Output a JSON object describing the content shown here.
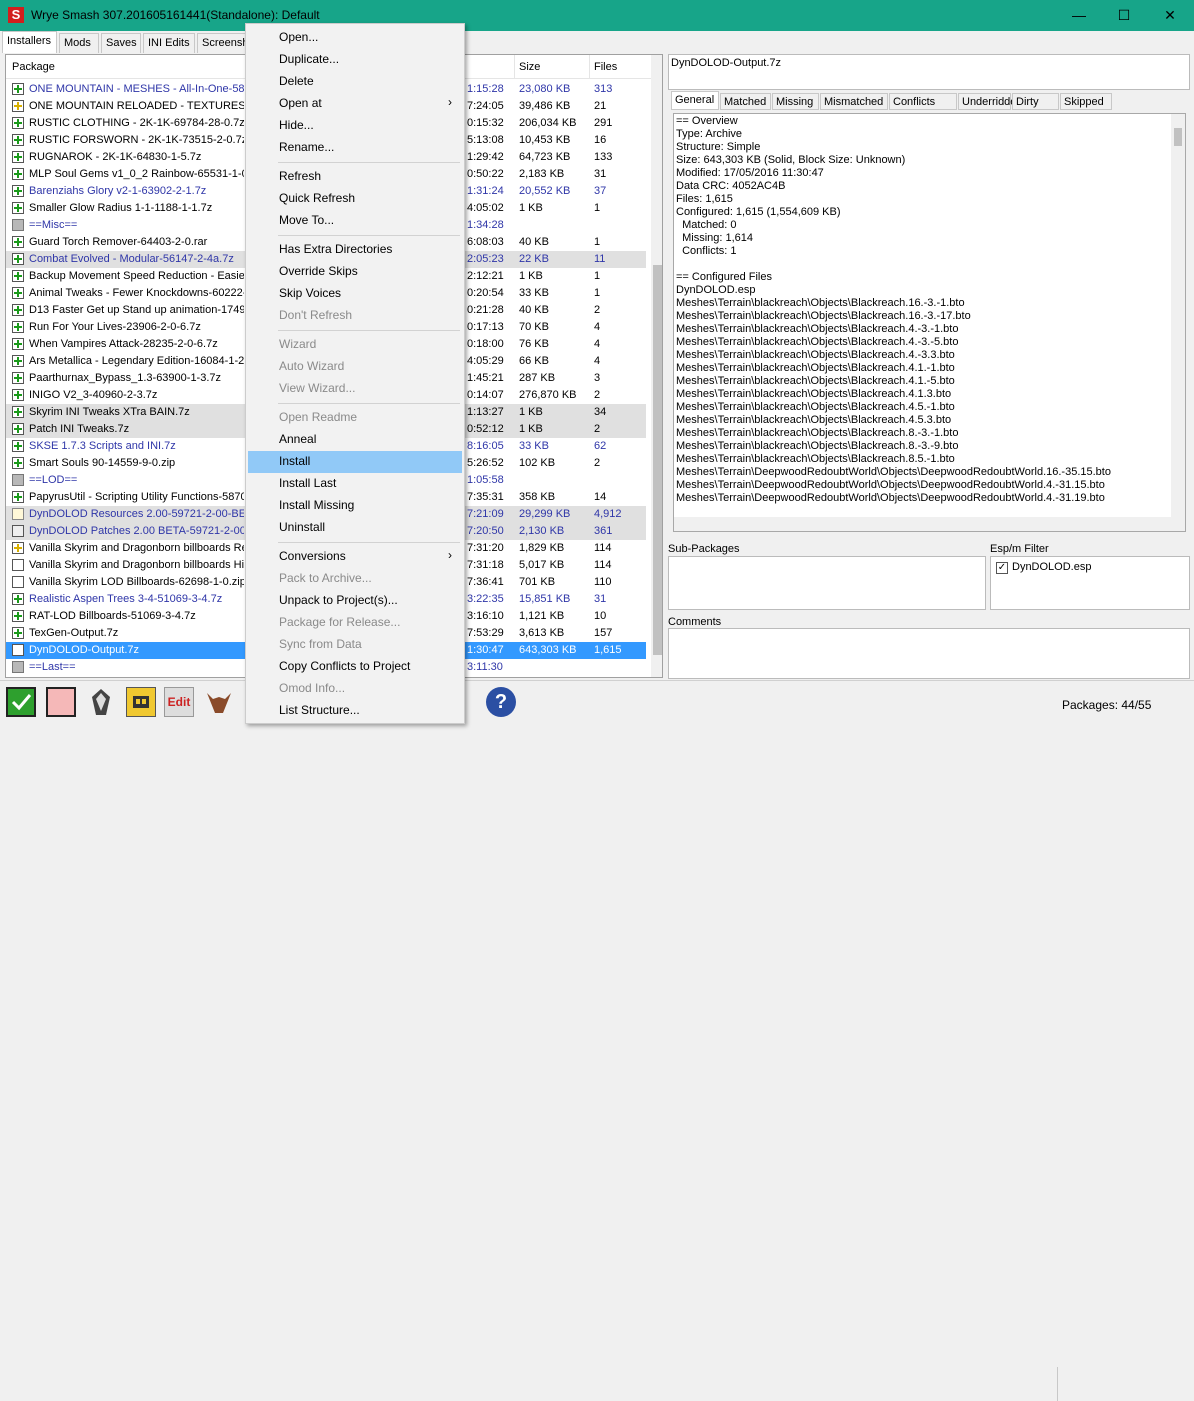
{
  "window": {
    "title": "Wrye Smash 307.201605161441(Standalone): Default",
    "app_icon_glyph": "S",
    "minimize_icon": "minimize-icon",
    "maximize_icon": "maximize-icon",
    "close_icon": "close-icon",
    "accent_color": "#17a589"
  },
  "tabs": [
    "Installers",
    "Mods",
    "Saves",
    "INI Edits",
    "Screensh"
  ],
  "list": {
    "headers": {
      "package": "Package",
      "size": "Size",
      "files": "Files"
    },
    "rows": [
      {
        "status": "green",
        "name": "ONE MOUNTAIN - MESHES - All-In-One-5866",
        "date": "1:15:28",
        "size": "23,080 KB",
        "files": "313",
        "style": "blue"
      },
      {
        "status": "yellow",
        "name": "ONE MOUNTAIN RELOADED - TEXTURES - 4K",
        "date": "7:24:05",
        "size": "39,486 KB",
        "files": "21",
        "style": ""
      },
      {
        "status": "green",
        "name": "RUSTIC CLOTHING - 2K-1K-69784-28-0.7z",
        "date": "0:15:32",
        "size": "206,034 KB",
        "files": "291",
        "style": ""
      },
      {
        "status": "green",
        "name": "RUSTIC FORSWORN - 2K-1K-73515-2-0.7z",
        "date": "5:13:08",
        "size": "10,453 KB",
        "files": "16",
        "style": ""
      },
      {
        "status": "green",
        "name": "RUGNAROK - 2K-1K-64830-1-5.7z",
        "date": "1:29:42",
        "size": "64,723 KB",
        "files": "133",
        "style": ""
      },
      {
        "status": "green",
        "name": "MLP Soul Gems v1_0_2 Rainbow-65531-1-0-2",
        "date": "0:50:22",
        "size": "2,183 KB",
        "files": "31",
        "style": ""
      },
      {
        "status": "green",
        "name": "Barenziahs Glory v2-1-63902-2-1.7z",
        "date": "1:31:24",
        "size": "20,552 KB",
        "files": "37",
        "style": "blue"
      },
      {
        "status": "green",
        "name": "Smaller Glow Radius 1-1-1188-1-1.7z",
        "date": "4:05:02",
        "size": "1 KB",
        "files": "1",
        "style": ""
      },
      {
        "status": "marker",
        "name": "==Misc==",
        "date": "1:34:28",
        "size": "",
        "files": "",
        "style": "blue"
      },
      {
        "status": "green",
        "name": "Guard Torch Remover-64403-2-0.rar",
        "date": "6:08:03",
        "size": "40 KB",
        "files": "1",
        "style": ""
      },
      {
        "status": "green",
        "name": "Combat Evolved - Modular-56147-2-4a.7z",
        "date": "2:05:23",
        "size": "22 KB",
        "files": "11",
        "style": "blue gray"
      },
      {
        "status": "green",
        "name": "Backup Movement Speed Reduction - Easier-",
        "date": "2:12:21",
        "size": "1 KB",
        "files": "1",
        "style": ""
      },
      {
        "status": "green",
        "name": "Animal Tweaks - Fewer Knockdowns-60222-2",
        "date": "0:20:54",
        "size": "33 KB",
        "files": "1",
        "style": ""
      },
      {
        "status": "green",
        "name": "D13 Faster Get up Stand up animation-17491",
        "date": "0:21:28",
        "size": "40 KB",
        "files": "2",
        "style": ""
      },
      {
        "status": "green",
        "name": "Run For Your Lives-23906-2-0-6.7z",
        "date": "0:17:13",
        "size": "70 KB",
        "files": "4",
        "style": ""
      },
      {
        "status": "green",
        "name": "When Vampires Attack-28235-2-0-6.7z",
        "date": "0:18:00",
        "size": "76 KB",
        "files": "4",
        "style": ""
      },
      {
        "status": "green",
        "name": "Ars Metallica - Legendary Edition-16084-1-2-",
        "date": "4:05:29",
        "size": "66 KB",
        "files": "4",
        "style": ""
      },
      {
        "status": "green",
        "name": "Paarthurnax_Bypass_1.3-63900-1-3.7z",
        "date": "1:45:21",
        "size": "287 KB",
        "files": "3",
        "style": ""
      },
      {
        "status": "green",
        "name": "INIGO V2_3-40960-2-3.7z",
        "date": "0:14:07",
        "size": "276,870 KB",
        "files": "2",
        "style": ""
      },
      {
        "status": "green",
        "name": "Skyrim INI Tweaks XTra BAIN.7z",
        "date": "1:13:27",
        "size": "1 KB",
        "files": "34",
        "style": "gray"
      },
      {
        "status": "green",
        "name": "Patch INI Tweaks.7z",
        "date": "0:52:12",
        "size": "1 KB",
        "files": "2",
        "style": "gray"
      },
      {
        "status": "green",
        "name": "SKSE 1.7.3 Scripts and INI.7z",
        "date": "8:16:05",
        "size": "33 KB",
        "files": "62",
        "style": "blue"
      },
      {
        "status": "green",
        "name": "Smart Souls 90-14559-9-0.zip",
        "date": "5:26:52",
        "size": "102 KB",
        "files": "2",
        "style": ""
      },
      {
        "status": "marker",
        "name": "==LOD==",
        "date": "1:05:58",
        "size": "",
        "files": "",
        "style": "blue"
      },
      {
        "status": "green",
        "name": "PapyrusUtil - Scripting Utility Functions-58705",
        "date": "7:35:31",
        "size": "358 KB",
        "files": "14",
        "style": ""
      },
      {
        "status": "wizard",
        "name": "DynDOLOD Resources 2.00-59721-2-00-BET",
        "date": "7:21:09",
        "size": "29,299 KB",
        "files": "4,912",
        "style": "blue gray"
      },
      {
        "status": "invalid",
        "name": "DynDOLOD Patches 2.00 BETA-59721-2-00-8",
        "date": "7:20:50",
        "size": "2,130 KB",
        "files": "361",
        "style": "blue gray"
      },
      {
        "status": "yellow",
        "name": "Vanilla Skyrim and Dragonborn billboards Red",
        "date": "7:31:20",
        "size": "1,829 KB",
        "files": "114",
        "style": ""
      },
      {
        "status": "empty",
        "name": "Vanilla Skyrim and Dragonborn billboards High",
        "date": "7:31:18",
        "size": "5,017 KB",
        "files": "114",
        "style": ""
      },
      {
        "status": "empty",
        "name": "Vanilla Skyrim LOD Billboards-62698-1-0.zip",
        "date": "7:36:41",
        "size": "701 KB",
        "files": "110",
        "style": ""
      },
      {
        "status": "green",
        "name": "Realistic Aspen Trees 3-4-51069-3-4.7z",
        "date": "3:22:35",
        "size": "15,851 KB",
        "files": "31",
        "style": "blue"
      },
      {
        "status": "green",
        "name": "RAT-LOD Billboards-51069-3-4.7z",
        "date": "3:16:10",
        "size": "1,121 KB",
        "files": "10",
        "style": ""
      },
      {
        "status": "green",
        "name": "TexGen-Output.7z",
        "date": "7:53:29",
        "size": "3,613 KB",
        "files": "157",
        "style": ""
      },
      {
        "status": "empty",
        "name": "DynDOLOD-Output.7z",
        "date": "1:30:47",
        "size": "643,303 KB",
        "files": "1,615",
        "style": "sel"
      },
      {
        "status": "marker",
        "name": "==Last==",
        "date": "3:11:30",
        "size": "",
        "files": "",
        "style": "blue"
      }
    ]
  },
  "context_menu": {
    "items": [
      {
        "label": "Open...",
        "disabled": false,
        "submenu": false
      },
      {
        "label": "Duplicate...",
        "disabled": false,
        "submenu": false
      },
      {
        "label": "Delete",
        "disabled": false,
        "submenu": false
      },
      {
        "label": "Open at",
        "disabled": false,
        "submenu": true
      },
      {
        "label": "Hide...",
        "disabled": false,
        "submenu": false
      },
      {
        "label": "Rename...",
        "disabled": false,
        "submenu": false
      },
      {
        "sep": true
      },
      {
        "label": "Refresh",
        "disabled": false,
        "submenu": false
      },
      {
        "label": "Quick Refresh",
        "disabled": false,
        "submenu": false
      },
      {
        "label": "Move To...",
        "disabled": false,
        "submenu": false
      },
      {
        "sep": true
      },
      {
        "label": "Has Extra Directories",
        "disabled": false,
        "submenu": false
      },
      {
        "label": "Override Skips",
        "disabled": false,
        "submenu": false
      },
      {
        "label": "Skip Voices",
        "disabled": false,
        "submenu": false
      },
      {
        "label": "Don't Refresh",
        "disabled": true,
        "submenu": false
      },
      {
        "sep": true
      },
      {
        "label": "Wizard",
        "disabled": true,
        "submenu": false
      },
      {
        "label": "Auto Wizard",
        "disabled": true,
        "submenu": false
      },
      {
        "label": "View Wizard...",
        "disabled": true,
        "submenu": false
      },
      {
        "sep": true
      },
      {
        "label": "Open Readme",
        "disabled": true,
        "submenu": false
      },
      {
        "label": "Anneal",
        "disabled": false,
        "submenu": false
      },
      {
        "label": "Install",
        "disabled": false,
        "submenu": false,
        "highlighted": true
      },
      {
        "label": "Install Last",
        "disabled": false,
        "submenu": false
      },
      {
        "label": "Install Missing",
        "disabled": false,
        "submenu": false
      },
      {
        "label": "Uninstall",
        "disabled": false,
        "submenu": false
      },
      {
        "sep": true
      },
      {
        "label": "Conversions",
        "disabled": false,
        "submenu": true
      },
      {
        "label": "Pack to Archive...",
        "disabled": true,
        "submenu": false
      },
      {
        "label": "Unpack to Project(s)...",
        "disabled": false,
        "submenu": false
      },
      {
        "label": "Package for Release...",
        "disabled": true,
        "submenu": false
      },
      {
        "label": "Sync from Data",
        "disabled": true,
        "submenu": false
      },
      {
        "label": "Copy Conflicts to Project",
        "disabled": false,
        "submenu": false
      },
      {
        "label": "Omod Info...",
        "disabled": true,
        "submenu": false
      },
      {
        "label": "List Structure...",
        "disabled": false,
        "submenu": false
      }
    ]
  },
  "details": {
    "package_name": "DynDOLOD-Output.7z",
    "tabs": [
      "General",
      "Matched",
      "Missing",
      "Mismatched",
      "Conflicts",
      "Underridden",
      "Dirty",
      "Skipped"
    ],
    "active_tab": "General",
    "lines": [
      "== Overview",
      "Type: Archive",
      "Structure: Simple",
      "Size: 643,303 KB (Solid, Block Size: Unknown)",
      "Modified: 17/05/2016 11:30:47",
      "Data CRC: 4052AC4B",
      "Files: 1,615",
      "Configured: 1,615 (1,554,609 KB)",
      "  Matched: 0",
      "  Missing: 1,614",
      "  Conflicts: 1",
      "",
      "== Configured Files",
      "DynDOLOD.esp",
      "Meshes\\Terrain\\blackreach\\Objects\\Blackreach.16.-3.-1.bto",
      "Meshes\\Terrain\\blackreach\\Objects\\Blackreach.16.-3.-17.bto",
      "Meshes\\Terrain\\blackreach\\Objects\\Blackreach.4.-3.-1.bto",
      "Meshes\\Terrain\\blackreach\\Objects\\Blackreach.4.-3.-5.bto",
      "Meshes\\Terrain\\blackreach\\Objects\\Blackreach.4.-3.3.bto",
      "Meshes\\Terrain\\blackreach\\Objects\\Blackreach.4.1.-1.bto",
      "Meshes\\Terrain\\blackreach\\Objects\\Blackreach.4.1.-5.bto",
      "Meshes\\Terrain\\blackreach\\Objects\\Blackreach.4.1.3.bto",
      "Meshes\\Terrain\\blackreach\\Objects\\Blackreach.4.5.-1.bto",
      "Meshes\\Terrain\\blackreach\\Objects\\Blackreach.4.5.3.bto",
      "Meshes\\Terrain\\blackreach\\Objects\\Blackreach.8.-3.-1.bto",
      "Meshes\\Terrain\\blackreach\\Objects\\Blackreach.8.-3.-9.bto",
      "Meshes\\Terrain\\blackreach\\Objects\\Blackreach.8.5.-1.bto",
      "Meshes\\Terrain\\DeepwoodRedoubtWorld\\Objects\\DeepwoodRedoubtWorld.16.-35.15.bto",
      "Meshes\\Terrain\\DeepwoodRedoubtWorld\\Objects\\DeepwoodRedoubtWorld.4.-31.15.bto",
      "Meshes\\Terrain\\DeepwoodRedoubtWorld\\Objects\\DeepwoodRedoubtWorld.4.-31.19.bto"
    ],
    "subpackages_label": "Sub-Packages",
    "espm_label": "Esp/m Filter",
    "espm_items": [
      {
        "name": "DynDOLOD.esp",
        "checked": true
      }
    ],
    "comments_label": "Comments"
  },
  "toolbar": {
    "icons": [
      "check-all-icon",
      "uncheck-all-icon",
      "skyrim-launcher-icon",
      "mod-organizer-icon",
      "edit-icon",
      "creature-icon",
      "help-icon"
    ],
    "edit_label": "Edit"
  },
  "status": {
    "packages": "Packages: 44/55"
  }
}
